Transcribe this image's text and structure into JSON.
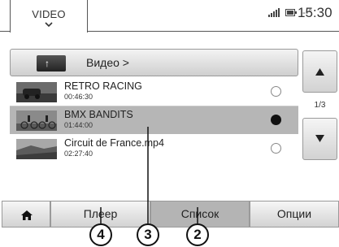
{
  "header": {
    "tab_label": "VIDEO",
    "temperature": "--°",
    "time": "15:30"
  },
  "folder": {
    "label": "Видео >"
  },
  "list": {
    "items": [
      {
        "title": "RETRO RACING",
        "duration": "00:46:30",
        "selected": false
      },
      {
        "title": "BMX BANDITS",
        "duration": "01:44:00",
        "selected": true
      },
      {
        "title": "Circuit de France.mp4",
        "duration": "02:27:40",
        "selected": false
      }
    ]
  },
  "pager": {
    "indicator": "1/3"
  },
  "bottom": {
    "player_label": "Плеер",
    "list_label": "Список",
    "options_label": "Опции"
  },
  "callouts": {
    "c2": "2",
    "c3": "3",
    "c4": "4"
  },
  "colors": {
    "selected_row": "#b6b6b6",
    "active_tab": "#b4b4b4"
  }
}
